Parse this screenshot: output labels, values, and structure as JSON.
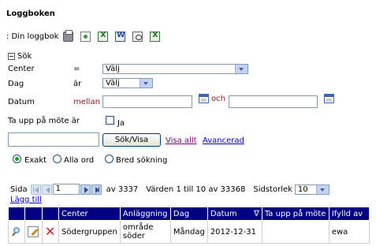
{
  "page": {
    "title": "Loggboken"
  },
  "logbook_bar": {
    "label": ": Din loggbok",
    "icons": [
      "print-icon",
      "document-icon",
      "excel-icon",
      "word-icon",
      "csv-icon",
      "excel-export-icon"
    ]
  },
  "search": {
    "toggle_label": "Sök",
    "center": {
      "label": "Center",
      "operator": "=",
      "value": "Välj"
    },
    "day": {
      "label": "Dag",
      "operator": "är",
      "value": "Välj"
    },
    "date": {
      "label": "Datum",
      "operator": "mellan",
      "and_label": "och",
      "from": "",
      "to": ""
    },
    "meeting": {
      "label": "Ta upp på möte är",
      "checkbox_label": "Ja"
    },
    "free_text": "",
    "search_button": "Sök/Visa",
    "show_all_link": "Visa allt",
    "advanced_link": "Avancerad",
    "modes": [
      {
        "label": "Exakt",
        "selected": true
      },
      {
        "label": "Alla ord",
        "selected": false
      },
      {
        "label": "Bred sökning",
        "selected": false
      }
    ]
  },
  "pager": {
    "page_label": "Sida",
    "current_page": "1",
    "of_pages": "av 3337",
    "values_text": "Värden 1 till 10 av 33368",
    "page_size_label": "Sidstorlek",
    "page_size": "10",
    "add_link": "Lägg till"
  },
  "table": {
    "columns": [
      "Center",
      "Anläggning",
      "Dag",
      "Datum",
      "Ta upp på möte",
      "Ifylld av"
    ],
    "sort_indicator": "∇",
    "rows": [
      {
        "center": "Södergruppen",
        "anlaggning": "område söder",
        "dag": "Måndag",
        "datum": "2012-12-31",
        "ta_upp": "",
        "ifylld_av": "ewa"
      }
    ]
  },
  "colors": {
    "header_bg": "#000080",
    "link": "#0000cc",
    "operator_text": "#8b1a1a"
  }
}
